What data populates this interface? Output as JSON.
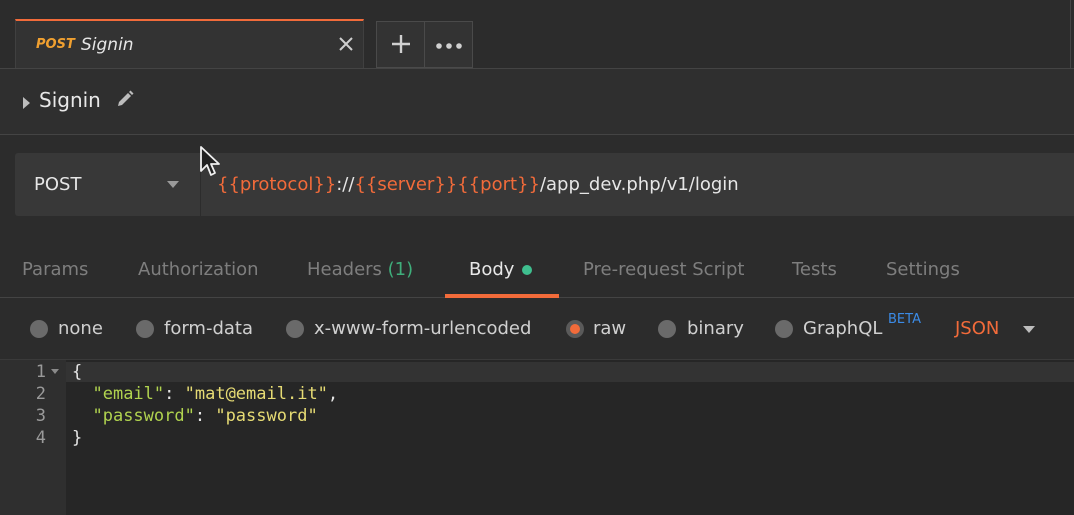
{
  "tab": {
    "method": "POST",
    "name": "Signin",
    "close_icon": "close-icon"
  },
  "tab_actions": {
    "new_tab": "+",
    "more": "•••"
  },
  "request": {
    "name": "Signin"
  },
  "url_bar": {
    "method": "POST",
    "segments": [
      {
        "text": "{{protocol}}",
        "var": true
      },
      {
        "text": "://",
        "var": false
      },
      {
        "text": "{{server}}",
        "var": true
      },
      {
        "text": "{{port}}",
        "var": true
      },
      {
        "text": "/app_dev.php/v1/login",
        "var": false
      }
    ]
  },
  "sub_tabs": {
    "params": "Params",
    "authorization": "Authorization",
    "headers": "Headers",
    "headers_count": "(1)",
    "body": "Body",
    "pre_request": "Pre-request Script",
    "tests": "Tests",
    "settings": "Settings"
  },
  "body_modes": {
    "none": "none",
    "form_data": "form-data",
    "urlencoded": "x-www-form-urlencoded",
    "raw": "raw",
    "binary": "binary",
    "graphql": "GraphQL",
    "beta": "BETA",
    "selected": "raw",
    "content_type": "JSON"
  },
  "editor": {
    "line_numbers": [
      "1",
      "2",
      "3",
      "4"
    ],
    "lines": {
      "l1": "{",
      "l2_key": "\"email\"",
      "l2_sep": ": ",
      "l2_val": "\"mat@email.it\"",
      "l2_end": ",",
      "l3_key": "\"password\"",
      "l3_sep": ": ",
      "l3_val": "\"password\"",
      "l4": "}"
    }
  },
  "colors": {
    "accent": "#f26b3a",
    "var": "#f26b3a",
    "method_tab": "#f0a030",
    "green": "#3fbf8f",
    "beta": "#3b8be6"
  }
}
